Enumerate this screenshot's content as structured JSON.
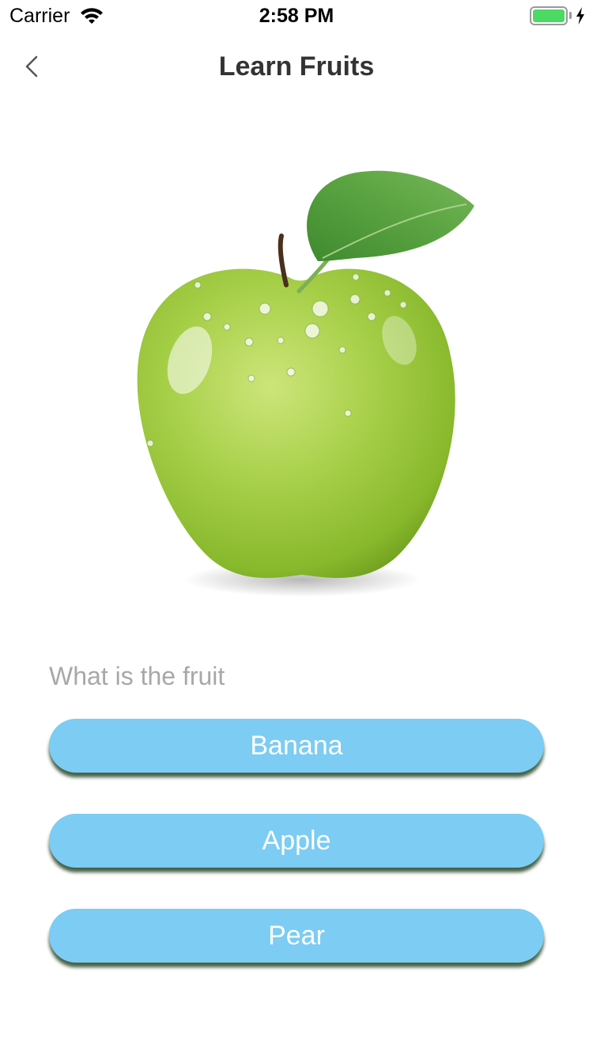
{
  "status_bar": {
    "carrier": "Carrier",
    "time": "2:58 PM",
    "battery_level": 1.0,
    "battery_color": "#4cd964",
    "wifi_icon": "wifi-icon",
    "charging_icon": "charging-bolt-icon"
  },
  "nav": {
    "title": "Learn Fruits",
    "back_icon": "chevron-left-icon"
  },
  "quiz": {
    "image": "green-apple",
    "question": "What is the fruit",
    "answers": [
      {
        "label": "Banana"
      },
      {
        "label": "Apple"
      },
      {
        "label": "Pear"
      }
    ],
    "button_color": "#7cccf3"
  }
}
